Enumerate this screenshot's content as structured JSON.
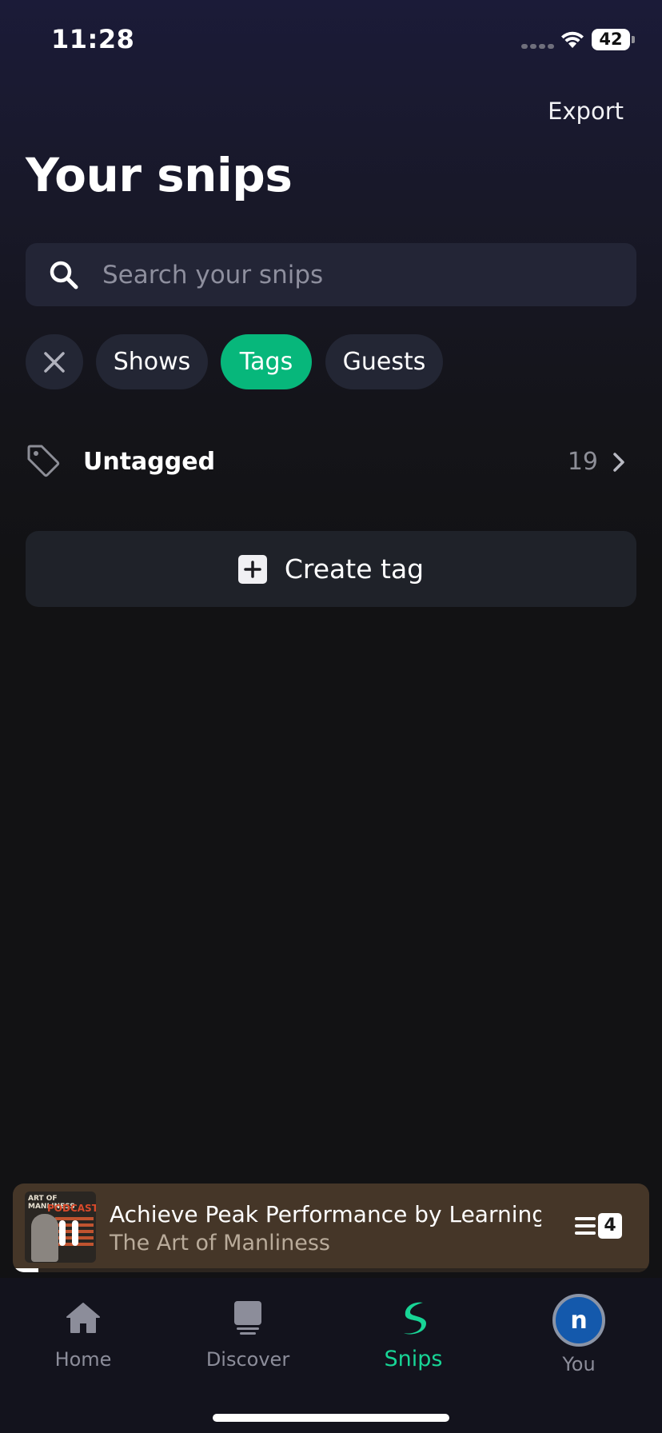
{
  "status_bar": {
    "time": "11:28",
    "battery": "42"
  },
  "header": {
    "export_label": "Export",
    "title": "Your snips"
  },
  "search": {
    "placeholder": "Search your snips",
    "value": ""
  },
  "filters": {
    "chips": [
      {
        "label": "Shows",
        "active": false
      },
      {
        "label": "Tags",
        "active": true
      },
      {
        "label": "Guests",
        "active": false
      }
    ]
  },
  "tags": {
    "untagged_label": "Untagged",
    "untagged_count": "19"
  },
  "create_tag": {
    "label": "Create tag"
  },
  "mini_player": {
    "title": "Achieve Peak Performance by Learning",
    "show": "The Art of Manliness",
    "queue_count": "4",
    "progress_fraction": 0.04,
    "artwork_text": "ART OF MANLINESS",
    "artwork_subtext": "PODCAST"
  },
  "tab_bar": {
    "tabs": [
      {
        "label": "Home",
        "icon": "house-icon",
        "active": false
      },
      {
        "label": "Discover",
        "icon": "discover-icon",
        "active": false
      },
      {
        "label": "Snips",
        "icon": "snips-logo-icon",
        "active": true
      },
      {
        "label": "You",
        "icon": "avatar",
        "active": false
      }
    ],
    "avatar_initial": "n"
  },
  "colors": {
    "accent": "#07b77b",
    "active_tab": "#18d596",
    "player_bg": "#453628",
    "avatar_bg": "#1459ac"
  }
}
